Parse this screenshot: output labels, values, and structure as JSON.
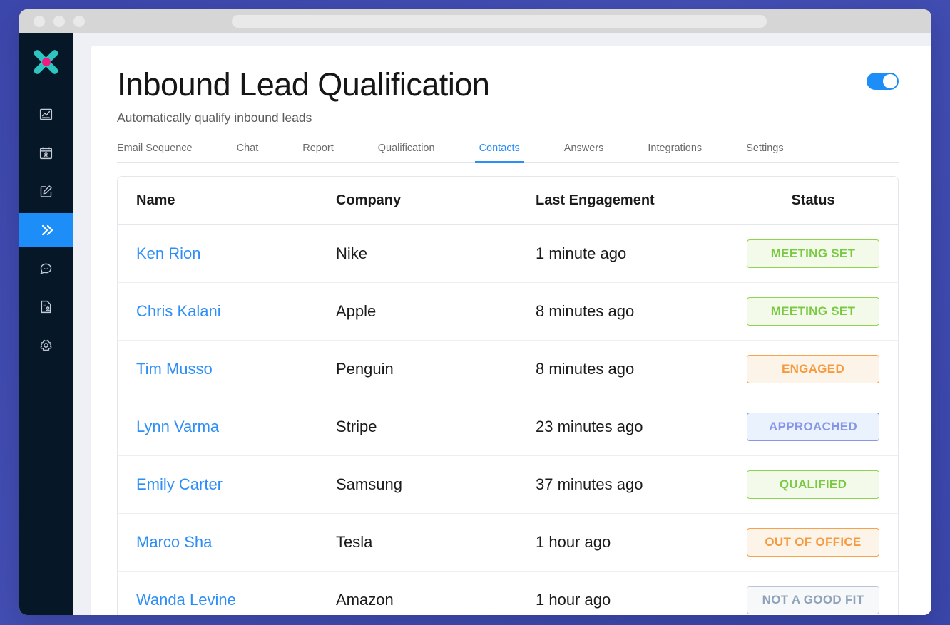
{
  "browser": {
    "traffic_lights": [
      "close",
      "minimize",
      "maximize"
    ],
    "address_bar_value": ""
  },
  "sidebar": {
    "logo_name": "x-logo",
    "logo_colors": {
      "petal": "#2ec4c0",
      "core": "#f01a82"
    },
    "items": [
      {
        "name": "analytics",
        "icon": "chart-icon",
        "active": false
      },
      {
        "name": "calendar",
        "icon": "calendar-person-icon",
        "active": false
      },
      {
        "name": "compose",
        "icon": "edit-square-icon",
        "active": false
      },
      {
        "name": "sequences",
        "icon": "double-chevron-right-icon",
        "active": true
      },
      {
        "name": "chat",
        "icon": "chat-bubble-icon",
        "active": false
      },
      {
        "name": "contacts",
        "icon": "contact-card-icon",
        "active": false
      },
      {
        "name": "settings",
        "icon": "gear-icon",
        "active": false
      }
    ],
    "active_color": "#1d8ef8",
    "background": "#061727"
  },
  "header": {
    "title": "Inbound Lead Qualification",
    "subtitle": "Automatically qualify inbound leads",
    "toggle_on": true,
    "toggle_color": "#1d8ef8"
  },
  "tabs": [
    {
      "label": "Email Sequence",
      "active": false
    },
    {
      "label": "Chat",
      "active": false
    },
    {
      "label": "Report",
      "active": false
    },
    {
      "label": "Qualification",
      "active": false
    },
    {
      "label": "Contacts",
      "active": true
    },
    {
      "label": "Answers",
      "active": false
    },
    {
      "label": "Integrations",
      "active": false
    },
    {
      "label": "Settings",
      "active": false
    }
  ],
  "table": {
    "columns": [
      "Name",
      "Company",
      "Last Engagement",
      "Status"
    ],
    "rows": [
      {
        "name": "Ken Rion",
        "company": "Nike",
        "last_engagement": "1 minute ago",
        "status": "MEETING SET",
        "status_style": "green"
      },
      {
        "name": "Chris Kalani",
        "company": "Apple",
        "last_engagement": "8 minutes ago",
        "status": "MEETING SET",
        "status_style": "green"
      },
      {
        "name": "Tim Musso",
        "company": "Penguin",
        "last_engagement": "8 minutes ago",
        "status": "ENGAGED",
        "status_style": "orange"
      },
      {
        "name": "Lynn Varma",
        "company": "Stripe",
        "last_engagement": "23 minutes ago",
        "status": "APPROACHED",
        "status_style": "purple"
      },
      {
        "name": "Emily Carter",
        "company": "Samsung",
        "last_engagement": "37 minutes ago",
        "status": "QUALIFIED",
        "status_style": "green"
      },
      {
        "name": "Marco Sha",
        "company": "Tesla",
        "last_engagement": "1 hour ago",
        "status": "OUT OF OFFICE",
        "status_style": "orange"
      },
      {
        "name": "Wanda Levine",
        "company": "Amazon",
        "last_engagement": "1 hour ago",
        "status": "NOT A GOOD FIT",
        "status_style": "gray"
      }
    ]
  },
  "colors": {
    "page_background": "#3f4bb0",
    "app_background": "#eef0f5",
    "link": "#2e8ef7",
    "accent": "#1d8ef8"
  }
}
